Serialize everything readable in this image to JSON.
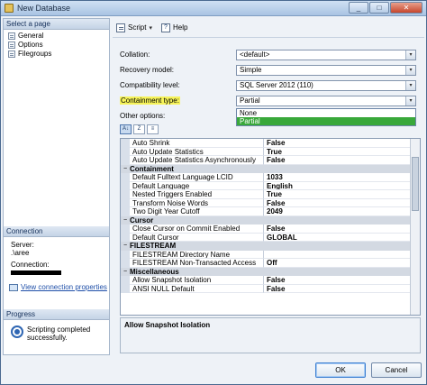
{
  "window": {
    "title": "New Database"
  },
  "left": {
    "select_page_header": "Select a page",
    "pages": [
      "General",
      "Options",
      "Filegroups"
    ],
    "connection_header": "Connection",
    "server_label": "Server:",
    "server_value": ".\\aree",
    "connection_label": "Connection:",
    "view_connection_link": "View connection properties",
    "progress_header": "Progress",
    "progress_text": "Scripting completed successfully."
  },
  "toolbar": {
    "script_label": "Script",
    "help_label": "Help",
    "help_icon_glyph": "?",
    "caret": "▾"
  },
  "options": {
    "collation_label": "Collation:",
    "collation_value": "<default>",
    "recovery_label": "Recovery model:",
    "recovery_value": "Simple",
    "compat_label": "Compatibility level:",
    "compat_value": "SQL Server 2012 (110)",
    "containment_label": "Containment type:",
    "containment_value": "Partial",
    "containment_options": [
      "None",
      "Partial"
    ],
    "other_options_label": "Other options:"
  },
  "grid_tool_glyphs": [
    "A↓",
    "Z",
    "≡"
  ],
  "dropdown_arrow": "▾",
  "grid": [
    {
      "type": "row",
      "name": "Auto Shrink",
      "value": "False"
    },
    {
      "type": "row",
      "name": "Auto Update Statistics",
      "value": "True"
    },
    {
      "type": "row",
      "name": "Auto Update Statistics Asynchronously",
      "value": "False"
    },
    {
      "type": "cat",
      "name": "Containment"
    },
    {
      "type": "row",
      "name": "Default Fulltext Language LCID",
      "value": "1033"
    },
    {
      "type": "row",
      "name": "Default Language",
      "value": "English"
    },
    {
      "type": "row",
      "name": "Nested Triggers Enabled",
      "value": "True"
    },
    {
      "type": "row",
      "name": "Transform Noise Words",
      "value": "False"
    },
    {
      "type": "row",
      "name": "Two Digit Year Cutoff",
      "value": "2049"
    },
    {
      "type": "cat",
      "name": "Cursor"
    },
    {
      "type": "row",
      "name": "Close Cursor on Commit Enabled",
      "value": "False"
    },
    {
      "type": "row",
      "name": "Default Cursor",
      "value": "GLOBAL"
    },
    {
      "type": "cat",
      "name": "FILESTREAM"
    },
    {
      "type": "row",
      "name": "FILESTREAM Directory Name",
      "value": ""
    },
    {
      "type": "row",
      "name": "FILESTREAM Non-Transacted Access",
      "value": "Off"
    },
    {
      "type": "cat",
      "name": "Miscellaneous"
    },
    {
      "type": "row",
      "name": "Allow Snapshot Isolation",
      "value": "False"
    },
    {
      "type": "row",
      "name": "ANSI NULL Default",
      "value": "False"
    }
  ],
  "description": "Allow Snapshot Isolation",
  "buttons": {
    "ok": "OK",
    "cancel": "Cancel"
  },
  "colors": {
    "highlight": "#f6f35a",
    "selection": "#39a83a",
    "link": "#1f4fa8"
  }
}
